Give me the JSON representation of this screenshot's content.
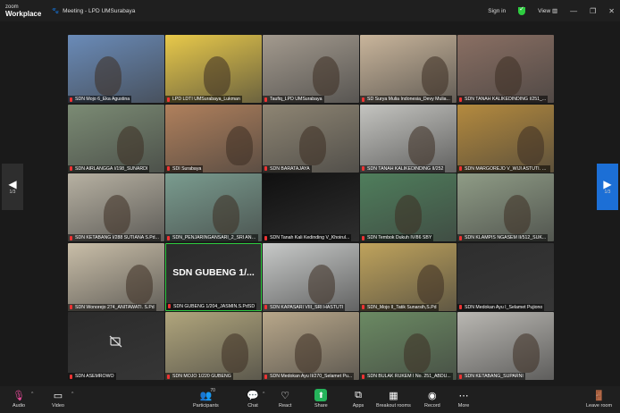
{
  "titlebar": {
    "app_name_line1": "zoom",
    "app_name_line2": "Workplace",
    "meeting_label": "Meeting - LPD UMSurabaya",
    "sign_in": "Sign in",
    "view": "View",
    "minimize_glyph": "—",
    "restore_glyph": "❐",
    "close_glyph": "✕"
  },
  "nav": {
    "page_indicator_left": "1/3",
    "page_indicator_right": "1/3"
  },
  "tiles": [
    {
      "name": "SDN Mojo 6_Eka Agustina",
      "bg": "#6a8bb8"
    },
    {
      "name": "LPD LDTI UMSurabaya_Lukman",
      "bg": "#e8c94a"
    },
    {
      "name": "Taufiq_LPD UMSurabaya",
      "bg": "#a39a8e"
    },
    {
      "name": "SD Surya Mulia Indonesia_Devy Mulia...",
      "bg": "#c9b59b"
    },
    {
      "name": "SDN TANAH KALIKEDINDING I/251_...",
      "bg": "#8a6f63"
    },
    {
      "name": "SDN AIRLANGGA I/198_SUNARDI",
      "bg": "#7b8b74"
    },
    {
      "name": "SDI Surabaya",
      "bg": "#b0805c"
    },
    {
      "name": "SDN BARATAJAYA",
      "bg": "#8e8573"
    },
    {
      "name": "SDN TANAH KALIKEDINDING II/252",
      "bg": "#c4c4c0"
    },
    {
      "name": "SDN MARGOREJO V_WIJI ASTUTI. S...",
      "bg": "#b48a3e"
    },
    {
      "name": "SDN KETABANG I/288 SUTIANA S.Pd...",
      "bg": "#b7b1a2"
    },
    {
      "name": "SDN_PENJARINGANSARI_2_SRI AND...",
      "bg": "#7a9c8f"
    },
    {
      "name": "SDN Tanah Kali Kedinding V_Khoirul...",
      "bg": "#101010"
    },
    {
      "name": "SDN Tembok Dukuh IV/86 SBY",
      "bg": "#4f7e5c"
    },
    {
      "name": "SDN KLAMPIS NGASEM II/512_SUK...",
      "bg": "#8f9c86"
    },
    {
      "name": "SDN Wonorejo 274_ANITAWATI. S.Pd",
      "bg": "#c9bea8"
    },
    {
      "name": "SDN GUBENG 1/204_JASMIN.S.PdSD",
      "bg": "#2b2b2b",
      "big_text": "SDN GUBENG 1/..."
    },
    {
      "name": "SDN KAPASARI VIII_SRI HASTUTI",
      "bg": "#c7c9c8"
    },
    {
      "name": "SDN_Mojo II_Tatik Sunarsih,S.Pd",
      "bg": "#bfa35c"
    },
    {
      "name": "SDN Medokan Ayu I_Selamet Pujiono",
      "bg": "#2e2e2e"
    },
    {
      "name": "SDN ASEMROWO",
      "bg": "#2b2b2b",
      "cam_off": true
    },
    {
      "name": "SDN MOJO 1/220 GUBENG",
      "bg": "#b0a57c"
    },
    {
      "name": "SDN Medokan Ayu II/270_Selamet Pu...",
      "bg": "#b8a78a"
    },
    {
      "name": "SDN BULAK RUKEM I No. 251_ABDU...",
      "bg": "#6b8a63"
    },
    {
      "name": "SDN KETABANG_SUPARNI",
      "bg": "#b9b7b2"
    }
  ],
  "toolbar": {
    "audio": "Audio",
    "video": "Video",
    "participants": "Participants",
    "participants_count": "70",
    "chat": "Chat",
    "react": "React",
    "share": "Share",
    "apps": "Apps",
    "breakout": "Breakout rooms",
    "record": "Record",
    "more": "More",
    "leave": "Leave room"
  }
}
